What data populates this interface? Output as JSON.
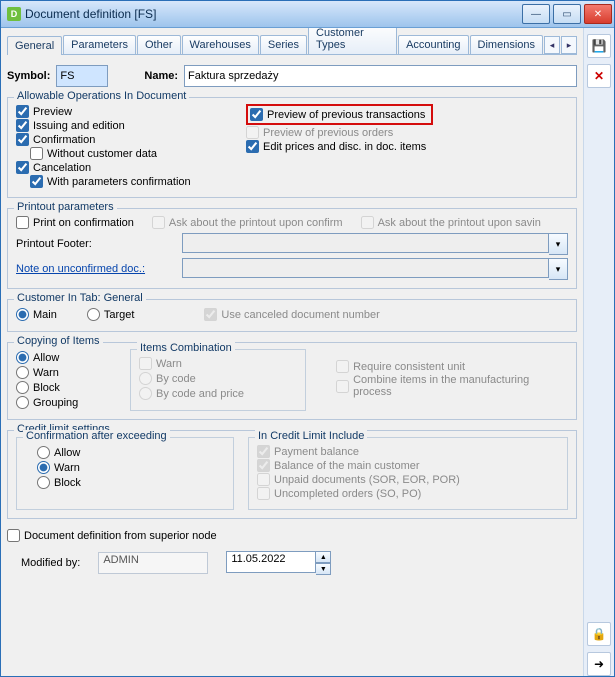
{
  "window": {
    "title": "Document definition [FS]"
  },
  "tabs": {
    "items": [
      "General",
      "Parameters",
      "Other",
      "Warehouses",
      "Series",
      "Customer Types",
      "Accounting",
      "Dimensions"
    ],
    "active": 0
  },
  "header": {
    "symbol_label": "Symbol:",
    "symbol_value": "FS",
    "name_label": "Name:",
    "name_value": "Faktura sprzedaży"
  },
  "allow": {
    "legend": "Allowable Operations In Document",
    "preview": "Preview",
    "issuing": "Issuing and edition",
    "confirmation": "Confirmation",
    "withoutCust": "Without customer data",
    "cancel": "Cancelation",
    "withParams": "With parameters confirmation",
    "prevTrans": "Preview of previous transactions",
    "prevOrders": "Preview of previous orders",
    "editPrices": "Edit prices and disc. in doc. items"
  },
  "printout": {
    "legend": "Printout parameters",
    "printOnConfirm": "Print on confirmation",
    "askConfirm": "Ask about the printout upon confirm",
    "askSaving": "Ask about the printout upon savin",
    "footerLabel": "Printout Footer:",
    "noteLabel": "Note on unconfirmed doc.:"
  },
  "custTab": {
    "legend": "Customer In Tab: General",
    "main": "Main",
    "target": "Target",
    "useCanceled": "Use canceled document number"
  },
  "copy": {
    "legend": "Copying of Items",
    "allow": "Allow",
    "warn": "Warn",
    "block": "Block",
    "grouping": "Grouping",
    "combo": {
      "legend": "Items Combination",
      "warn": "Warn",
      "byCode": "By code",
      "byCodePrice": "By code and price"
    },
    "reqUnit": "Require consistent unit",
    "combineManuf": "Combine items in the manufacturing process"
  },
  "credit": {
    "legend": "Credit limit settings",
    "confLegend": "Confirmation after exceeding",
    "allow": "Allow",
    "warn": "Warn",
    "block": "Block",
    "inclLegend": "In Credit Limit Include",
    "payBal": "Payment balance",
    "balMain": "Balance of the main customer",
    "unpaid": "Unpaid documents (SOR, EOR, POR)",
    "uncompleted": "Uncompleted orders (SO, PO)"
  },
  "docDefSuperior": "Document definition from superior node",
  "modified": {
    "label": "Modified by:",
    "user": "ADMIN",
    "date": "11.05.2022"
  }
}
